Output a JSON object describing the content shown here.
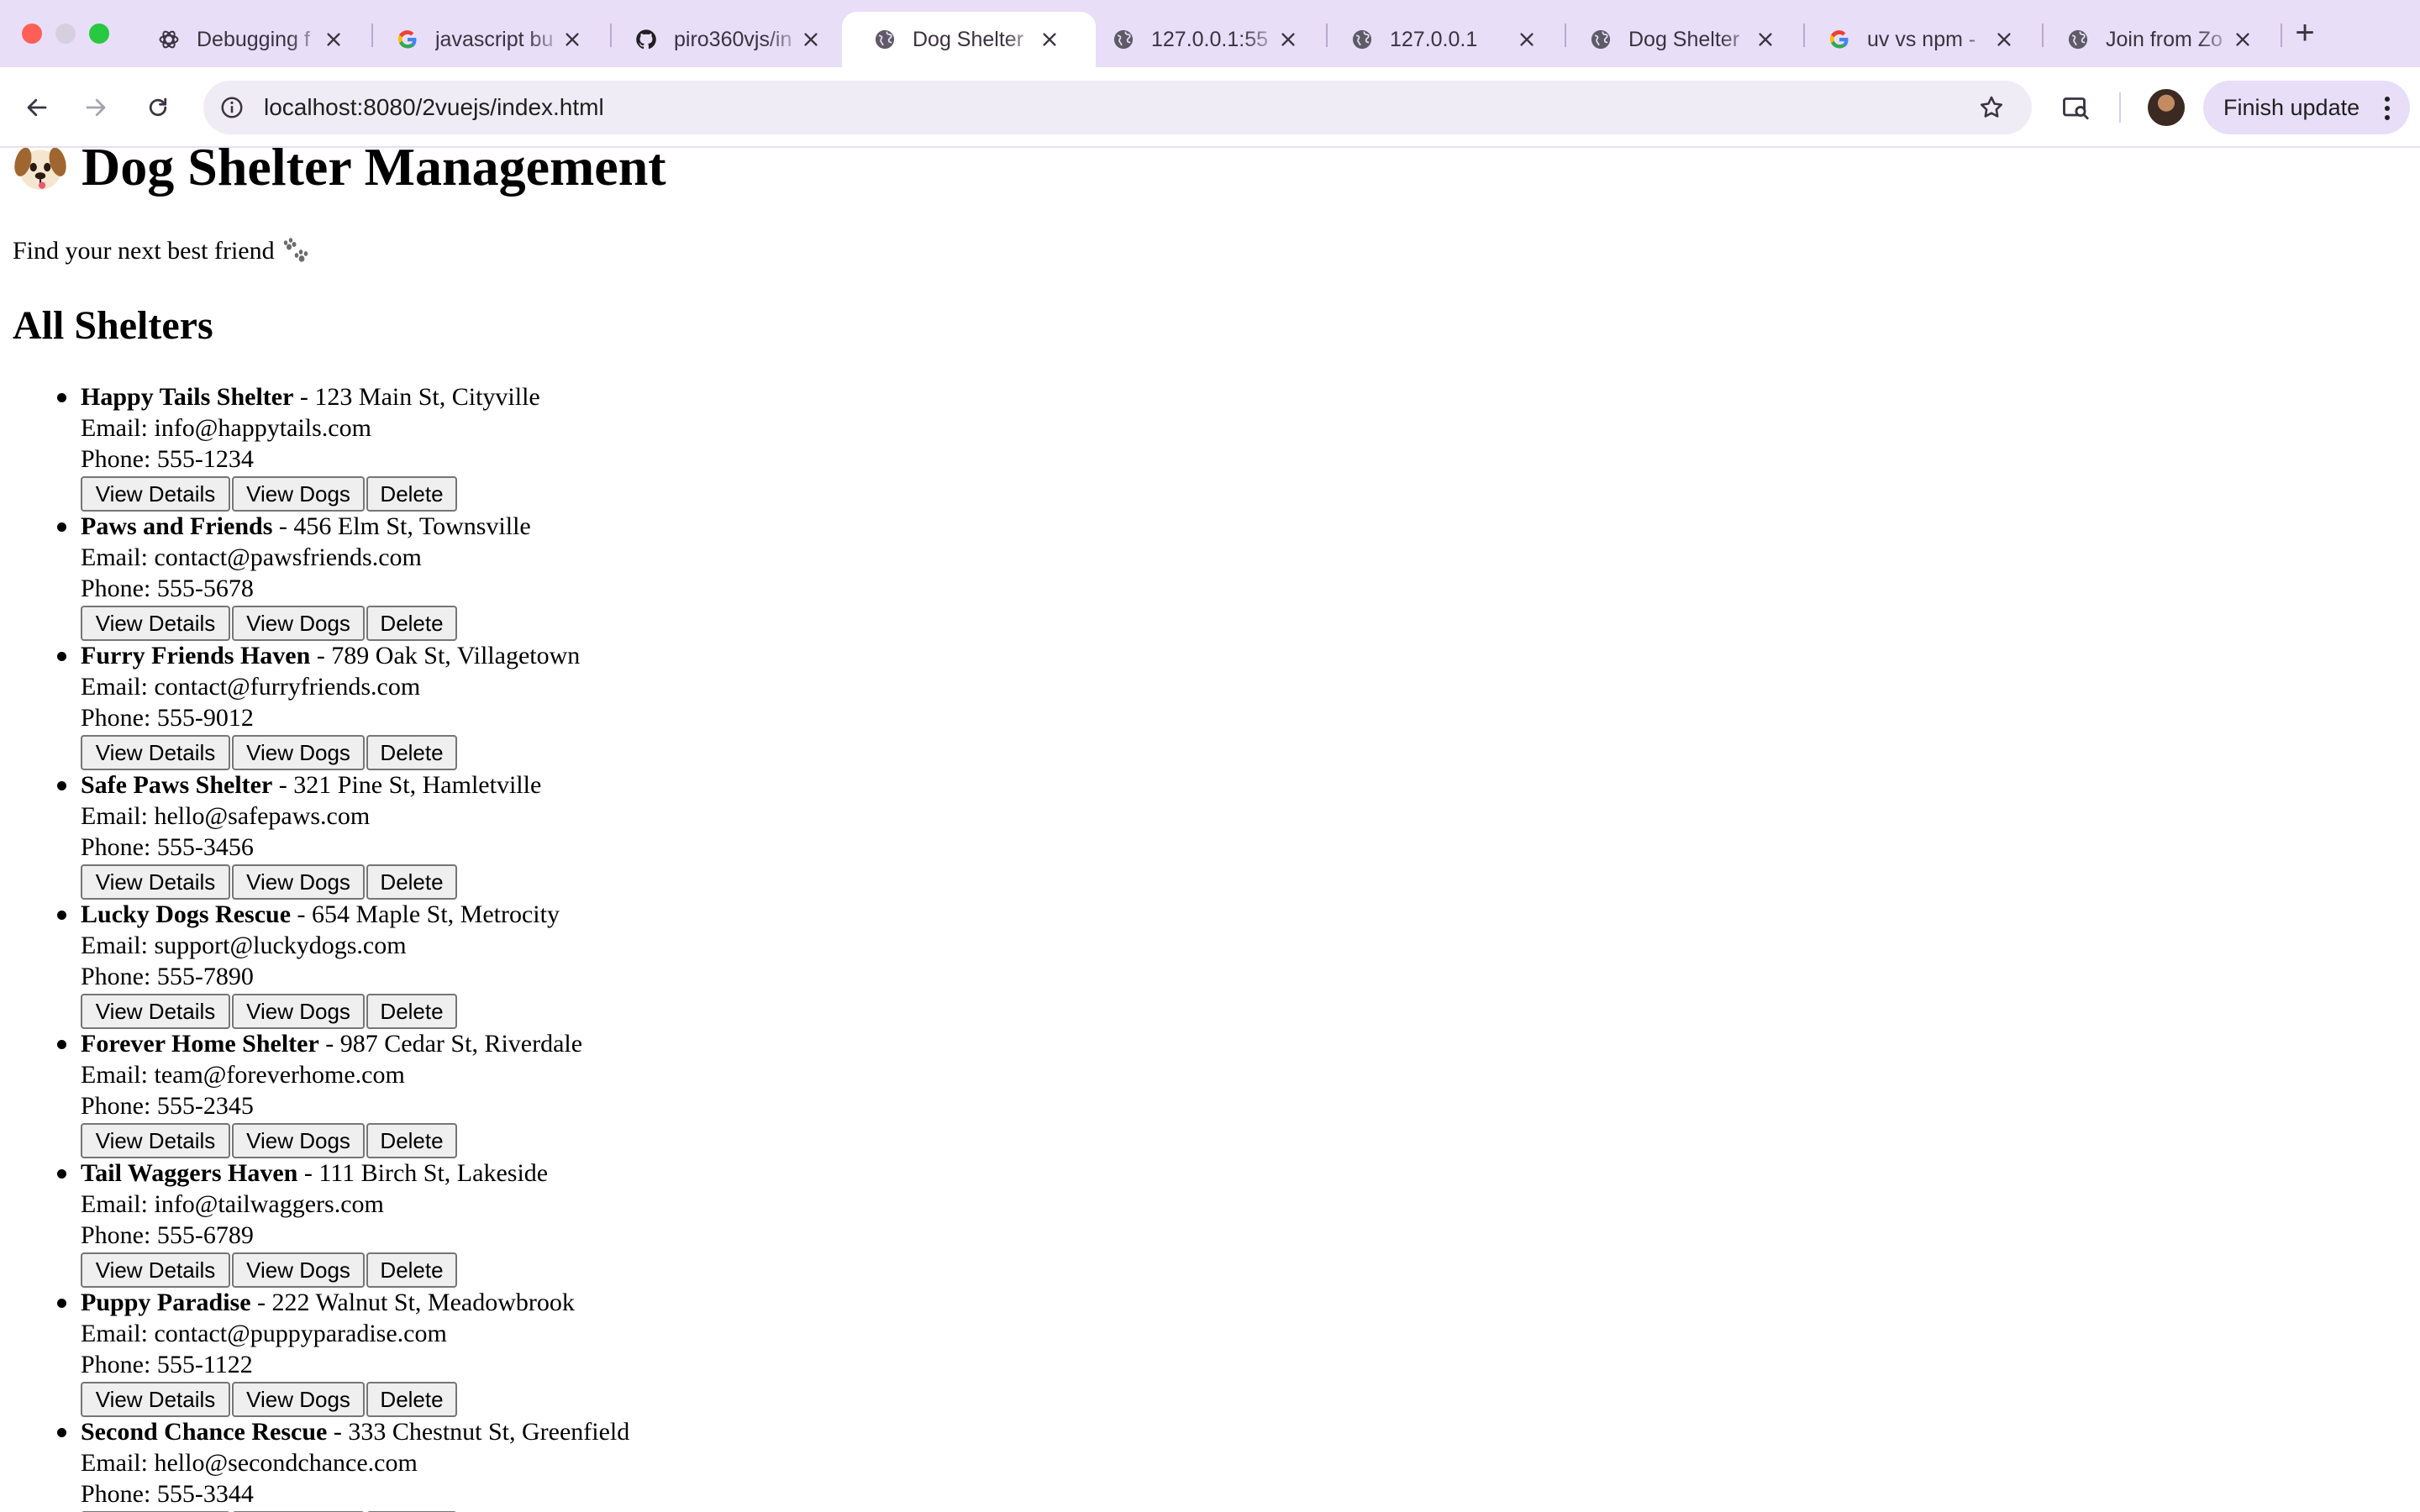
{
  "browser": {
    "tabs": [
      {
        "title": "Debugging f",
        "favicon": "openai-icon",
        "active": false
      },
      {
        "title": "javascript bu",
        "favicon": "google-icon",
        "active": false
      },
      {
        "title": "piro360vjs/in",
        "favicon": "github-icon",
        "active": false
      },
      {
        "title": "Dog Shelter",
        "favicon": "globe-icon",
        "active": true
      },
      {
        "title": "127.0.0.1:55",
        "favicon": "globe-icon",
        "active": false
      },
      {
        "title": "127.0.0.1",
        "favicon": "globe-icon",
        "active": false
      },
      {
        "title": "Dog Shelter",
        "favicon": "globe-icon",
        "active": false
      },
      {
        "title": "uv vs npm -",
        "favicon": "google-icon",
        "active": false
      },
      {
        "title": "Join from Zo",
        "favicon": "globe-icon",
        "active": false
      }
    ],
    "new_tab_label": "+",
    "url": "localhost:8080/2vuejs/index.html",
    "finish_update_label": "Finish update"
  },
  "page": {
    "title": "Dog Shelter Management",
    "tagline": "Find your next best friend",
    "section_title": "All Shelters",
    "email_prefix": "Email: ",
    "phone_prefix": "Phone: ",
    "buttons": {
      "view_details": "View Details",
      "view_dogs": "View Dogs",
      "delete": "Delete"
    },
    "shelters": [
      {
        "name": "Happy Tails Shelter",
        "address": " - 123 Main St, Cityville",
        "email": "info@happytails.com",
        "phone": "555-1234"
      },
      {
        "name": "Paws and Friends",
        "address": " - 456 Elm St, Townsville",
        "email": "contact@pawsfriends.com",
        "phone": "555-5678"
      },
      {
        "name": "Furry Friends Haven",
        "address": " - 789 Oak St, Villagetown",
        "email": "contact@furryfriends.com",
        "phone": "555-9012"
      },
      {
        "name": "Safe Paws Shelter",
        "address": " - 321 Pine St, Hamletville",
        "email": "hello@safepaws.com",
        "phone": "555-3456"
      },
      {
        "name": "Lucky Dogs Rescue",
        "address": " - 654 Maple St, Metrocity",
        "email": "support@luckydogs.com",
        "phone": "555-7890"
      },
      {
        "name": "Forever Home Shelter",
        "address": " - 987 Cedar St, Riverdale",
        "email": "team@foreverhome.com",
        "phone": "555-2345"
      },
      {
        "name": "Tail Waggers Haven",
        "address": " - 111 Birch St, Lakeside",
        "email": "info@tailwaggers.com",
        "phone": "555-6789"
      },
      {
        "name": "Puppy Paradise",
        "address": " - 222 Walnut St, Meadowbrook",
        "email": "contact@puppyparadise.com",
        "phone": "555-1122"
      },
      {
        "name": "Second Chance Rescue",
        "address": " - 333 Chestnut St, Greenfield",
        "email": "hello@secondchance.com",
        "phone": "555-3344"
      }
    ]
  }
}
